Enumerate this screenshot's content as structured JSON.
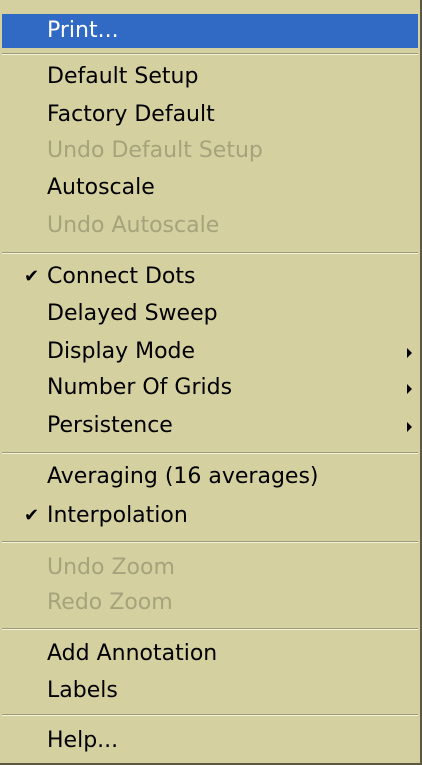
{
  "menu": {
    "print": "Print...",
    "default_setup": "Default Setup",
    "factory_default": "Factory Default",
    "undo_default_setup": "Undo Default Setup",
    "autoscale": "Autoscale",
    "undo_autoscale": "Undo Autoscale",
    "connect_dots": "Connect Dots",
    "delayed_sweep": "Delayed Sweep",
    "display_mode": "Display Mode",
    "number_of_grids": "Number Of Grids",
    "persistence": "Persistence",
    "averaging": "Averaging (16  averages)",
    "interpolation": "Interpolation",
    "undo_zoom": "Undo Zoom",
    "redo_zoom": "Redo Zoom",
    "add_annotation": "Add Annotation",
    "labels": "Labels",
    "help": "Help...",
    "check_glyph": "✔"
  },
  "colors": {
    "menu_background": "#d4d0a0",
    "highlight": "#316ac5",
    "disabled_text": "#a6a37c"
  }
}
